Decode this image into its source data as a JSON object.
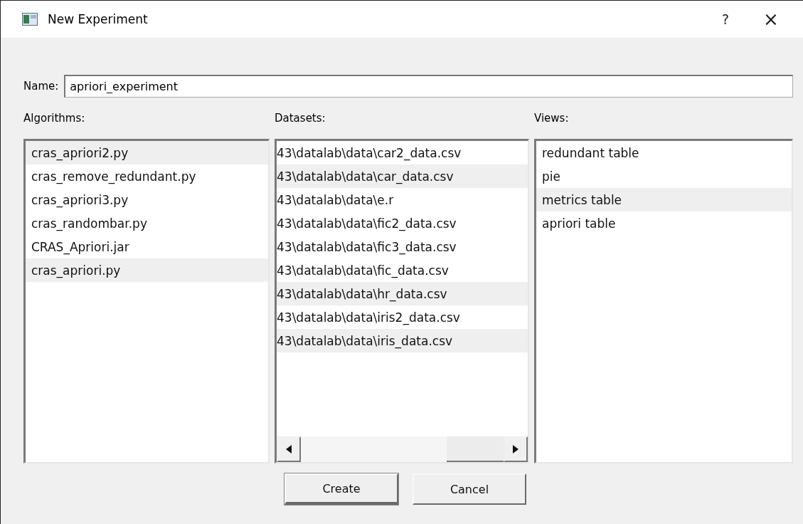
{
  "window": {
    "title": "New Experiment",
    "help": "?",
    "close": "×"
  },
  "name_field": {
    "label": "Name:",
    "value": "apriori_experiment"
  },
  "lists": [
    {
      "label": "Algorithms:",
      "horizontal_scrollbar": false,
      "items": [
        {
          "text": "cras_apriori2.py",
          "selected": true
        },
        {
          "text": "cras_remove_redundant.py",
          "selected": false
        },
        {
          "text": "cras_apriori3.py",
          "selected": false
        },
        {
          "text": "cras_randombar.py",
          "selected": false
        },
        {
          "text": "CRAS_Apriori.jar",
          "selected": false
        },
        {
          "text": "cras_apriori.py",
          "selected": true
        }
      ]
    },
    {
      "label": "Datasets:",
      "horizontal_scrollbar": true,
      "items": [
        {
          "text": "43\\datalab\\data\\car2_data.csv",
          "selected": false
        },
        {
          "text": "43\\datalab\\data\\car_data.csv",
          "selected": true
        },
        {
          "text": "43\\datalab\\data\\e.r",
          "selected": false
        },
        {
          "text": "43\\datalab\\data\\fic2_data.csv",
          "selected": false
        },
        {
          "text": "43\\datalab\\data\\fic3_data.csv",
          "selected": false
        },
        {
          "text": "43\\datalab\\data\\fic_data.csv",
          "selected": false
        },
        {
          "text": "43\\datalab\\data\\hr_data.csv",
          "selected": true
        },
        {
          "text": "43\\datalab\\data\\iris2_data.csv",
          "selected": false
        },
        {
          "text": "43\\datalab\\data\\iris_data.csv",
          "selected": true
        }
      ]
    },
    {
      "label": "Views:",
      "horizontal_scrollbar": false,
      "items": [
        {
          "text": "redundant table",
          "selected": false
        },
        {
          "text": "pie",
          "selected": false
        },
        {
          "text": "metrics table",
          "selected": true
        },
        {
          "text": "apriori table",
          "selected": false
        }
      ]
    }
  ],
  "buttons": [
    {
      "label": "Create",
      "default": true
    },
    {
      "label": "Cancel",
      "default": false
    }
  ]
}
